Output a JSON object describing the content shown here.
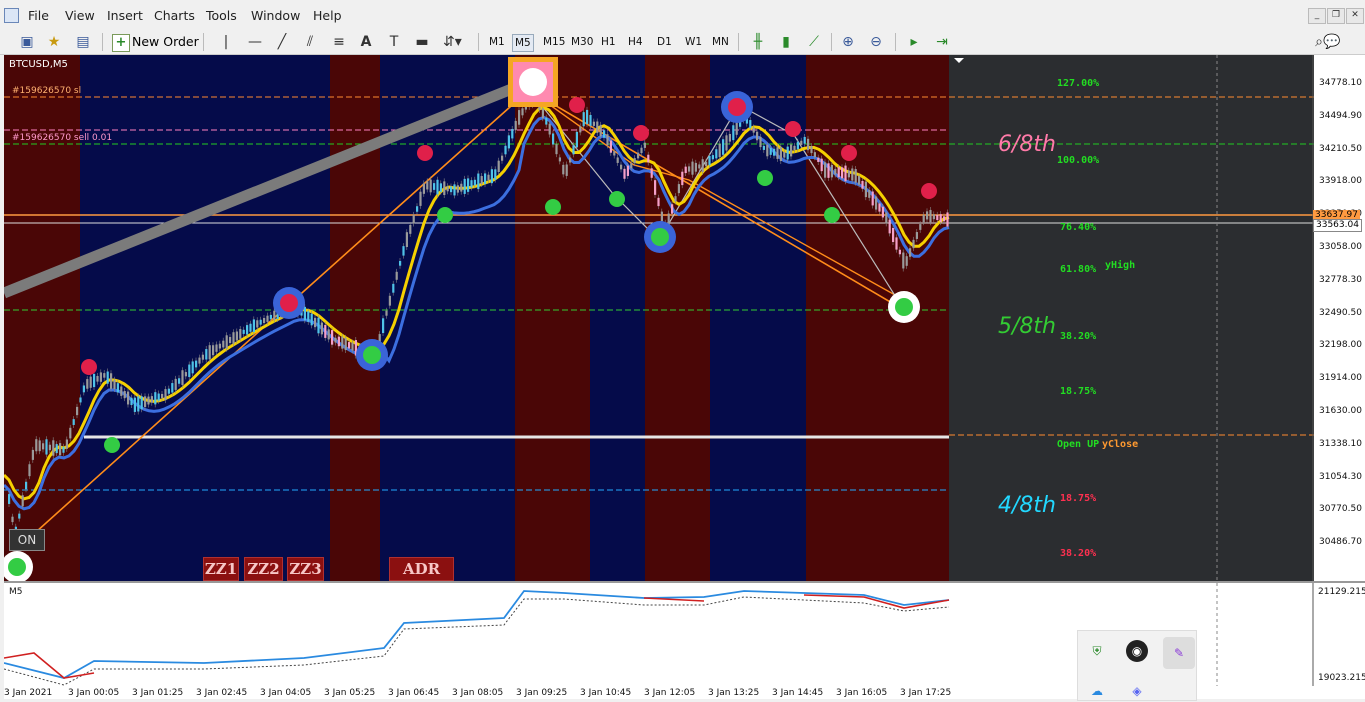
{
  "window": {
    "menu": [
      "File",
      "View",
      "Insert",
      "Charts",
      "Tools",
      "Window",
      "Help"
    ]
  },
  "toolbar": {
    "new_order_label": "New Order",
    "timeframes": [
      "M1",
      "M5",
      "M15",
      "M30",
      "H1",
      "H4",
      "D1",
      "W1",
      "MN"
    ],
    "active_timeframe": "M5",
    "notification_count": "1"
  },
  "chart": {
    "symbol_label": "BTCUSD,M5",
    "order_lines": [
      {
        "label": "#159626570 sl",
        "color": "#ff8a30"
      },
      {
        "label": "#159626570 sell 0.01",
        "color": "#ff80c0"
      }
    ],
    "fib_levels": [
      {
        "label": "127.00%",
        "color": "#22dd22"
      },
      {
        "label": "100.00%",
        "color": "#22dd22"
      },
      {
        "label": "76.40%",
        "color": "#22dd22"
      },
      {
        "label": "61.80%",
        "color": "#22dd22"
      },
      {
        "label": "38.20%",
        "color": "#22dd22"
      },
      {
        "label": "18.75%",
        "color": "#22dd22"
      },
      {
        "label": "18.75%",
        "color": "#ff3050"
      },
      {
        "label": "38.20%",
        "color": "#ff3050"
      }
    ],
    "y_high_label": "yHigh",
    "open_up_label": "Open UP",
    "y_close_label": "yClose",
    "eighths": [
      {
        "label": "6/8th",
        "color": "#ff7aa8"
      },
      {
        "label": "5/8th",
        "color": "#33cc33"
      },
      {
        "label": "4/8th",
        "color": "#22d8ff"
      }
    ],
    "buttons": [
      "ZZ1",
      "ZZ2",
      "ZZ3",
      "ADR D1"
    ],
    "on_button": "ON",
    "price_axis": [
      "34778.10",
      "34494.90",
      "34210.50",
      "33918.00",
      "33350.20",
      "33058.00",
      "32778.30",
      "32490.50",
      "32198.00",
      "31914.00",
      "31630.00",
      "31338.10",
      "31054.30",
      "30770.50",
      "30486.70"
    ],
    "current_price": "33637.97",
    "bid_price": "33563.04",
    "indicator_label": "M5",
    "indicator_axis": [
      "21129.2151",
      "19023.2151"
    ],
    "time_axis": [
      "3 Jan 2021",
      "3 Jan 00:05",
      "3 Jan 01:25",
      "3 Jan 02:45",
      "3 Jan 04:05",
      "3 Jan 05:25",
      "3 Jan 06:45",
      "3 Jan 08:05",
      "3 Jan 09:25",
      "3 Jan 10:45",
      "3 Jan 12:05",
      "3 Jan 13:25",
      "3 Jan 14:45",
      "3 Jan 16:05",
      "3 Jan 17:25"
    ]
  }
}
